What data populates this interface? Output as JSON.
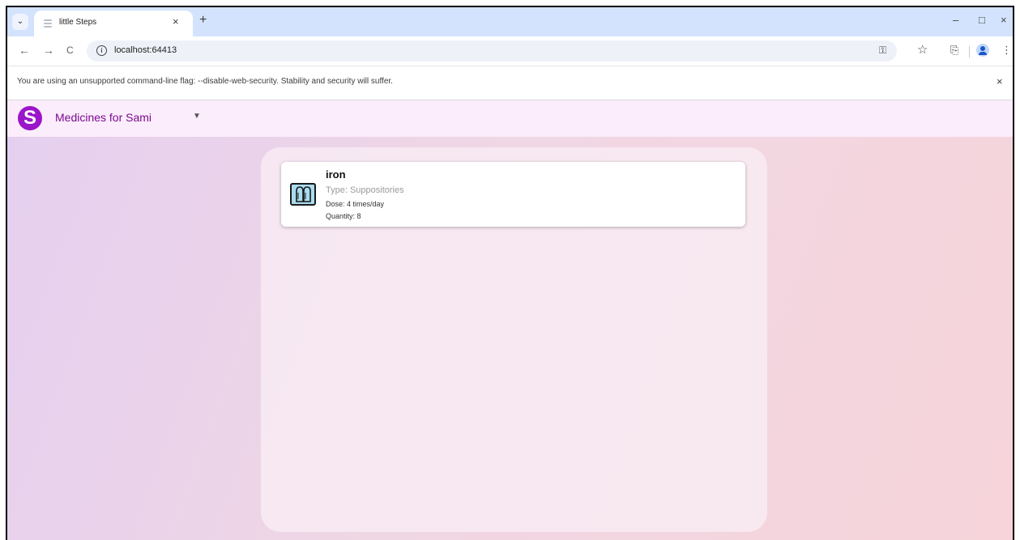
{
  "browser": {
    "tab_title": "little Steps",
    "tab_close": "×",
    "new_tab": "+",
    "tab_menu": "⌄",
    "url": "localhost:64413",
    "window_controls": {
      "minimize": "–",
      "maximize": "□",
      "close": "×"
    },
    "toolbar": {
      "back": "←",
      "forward": "→",
      "reload": "C",
      "star": "☆",
      "menu": "⋮",
      "key": "⚿",
      "extensions": "⎘"
    }
  },
  "infobar": {
    "message": "You are using an unsupported command-line flag: --disable-web-security. Stability and security will suffer.",
    "close": "×"
  },
  "app": {
    "logo_letter": "S",
    "title": "Medicines for Sami",
    "dropdown": "▼",
    "accent_color": "#9b15c9",
    "medicines": [
      {
        "name": "iron",
        "type": "Type: Suppositories",
        "dose": "Dose: 4 times/day",
        "quantity": "Quantity: 8",
        "icon": "suppository-icon"
      }
    ]
  }
}
